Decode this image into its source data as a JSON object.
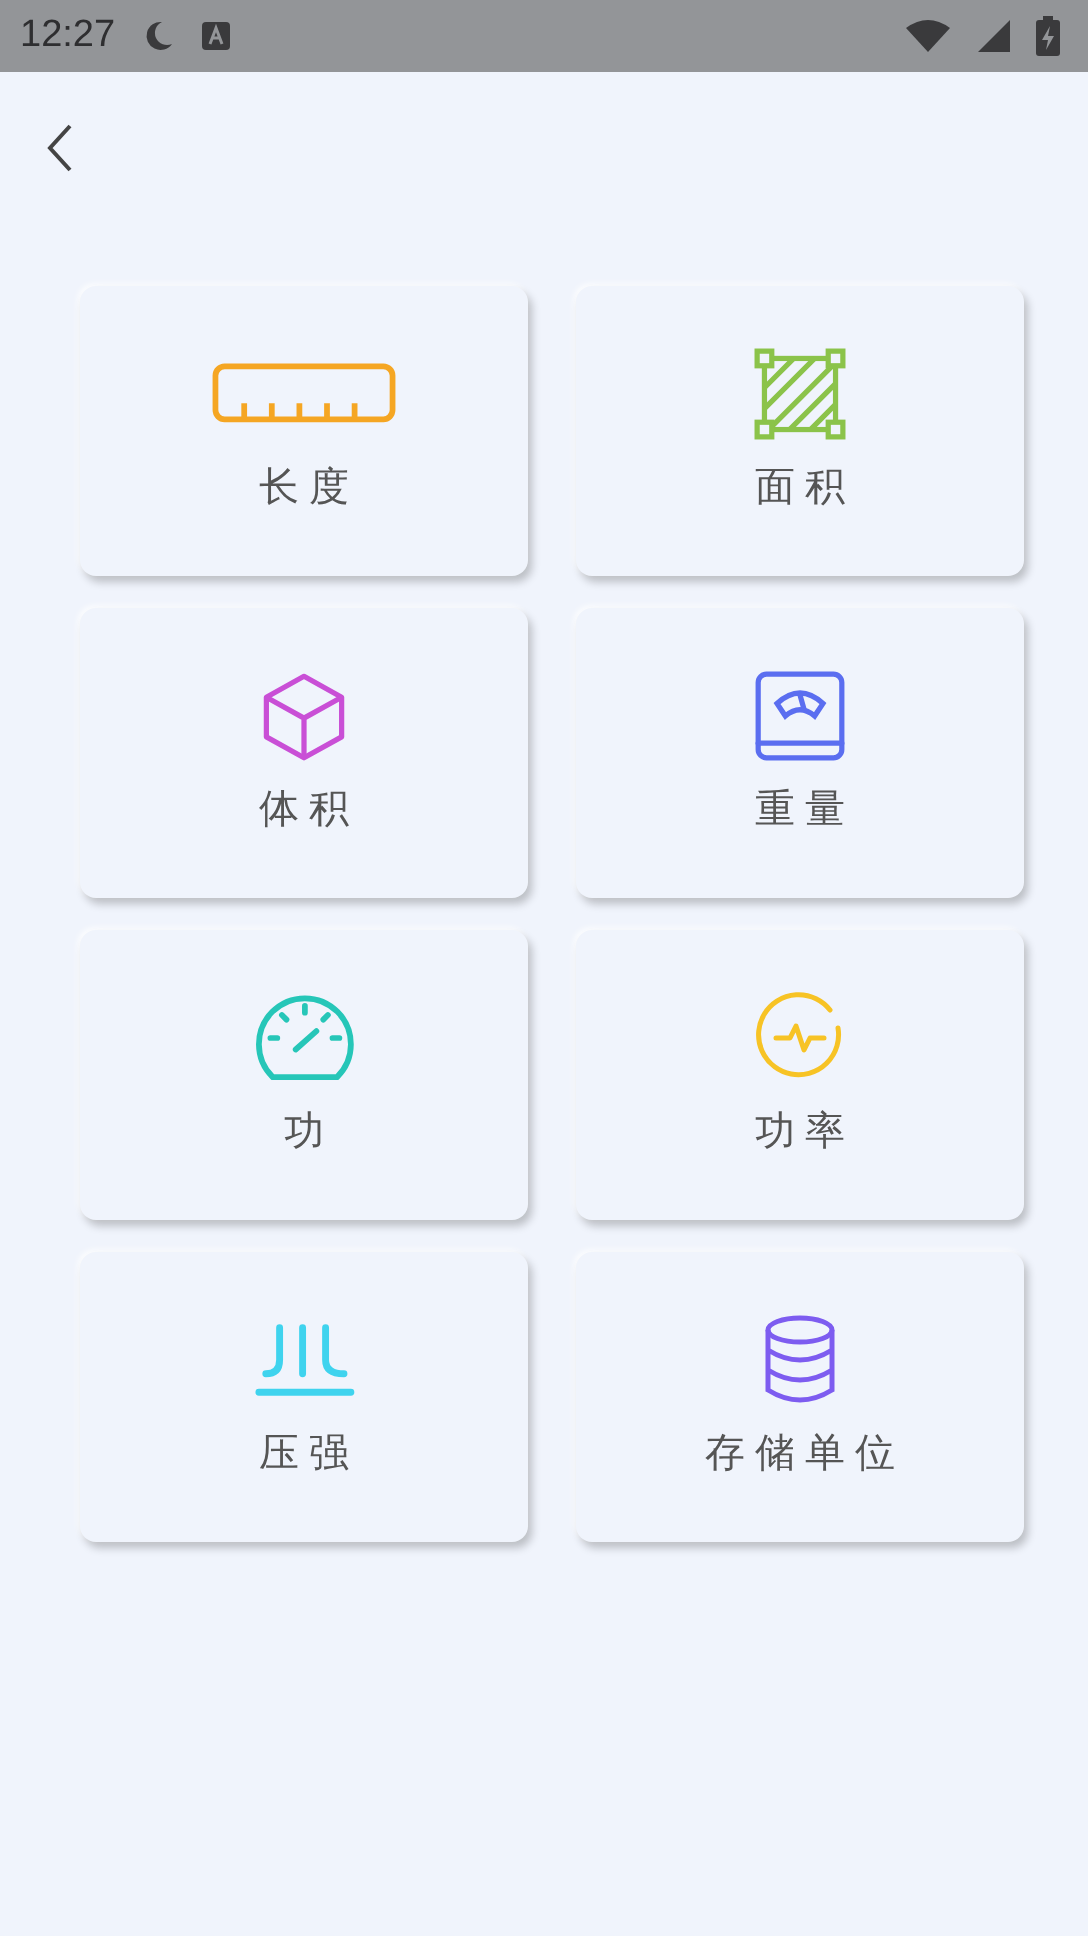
{
  "status_bar": {
    "time": "12:27"
  },
  "items": [
    {
      "label": "长度",
      "kind": "ruler",
      "color": "#f5a623"
    },
    {
      "label": "面积",
      "kind": "area",
      "color": "#8bc34a"
    },
    {
      "label": "体积",
      "kind": "cube",
      "color": "#c94fd6"
    },
    {
      "label": "重量",
      "kind": "scale",
      "color": "#5b6ef0"
    },
    {
      "label": "功",
      "kind": "gauge",
      "color": "#26c6b8"
    },
    {
      "label": "功率",
      "kind": "pulse",
      "color": "#f7c325"
    },
    {
      "label": "压强",
      "kind": "pressure",
      "color": "#3fd3ee"
    },
    {
      "label": "存储单位",
      "kind": "database",
      "color": "#7d5cf0"
    }
  ]
}
